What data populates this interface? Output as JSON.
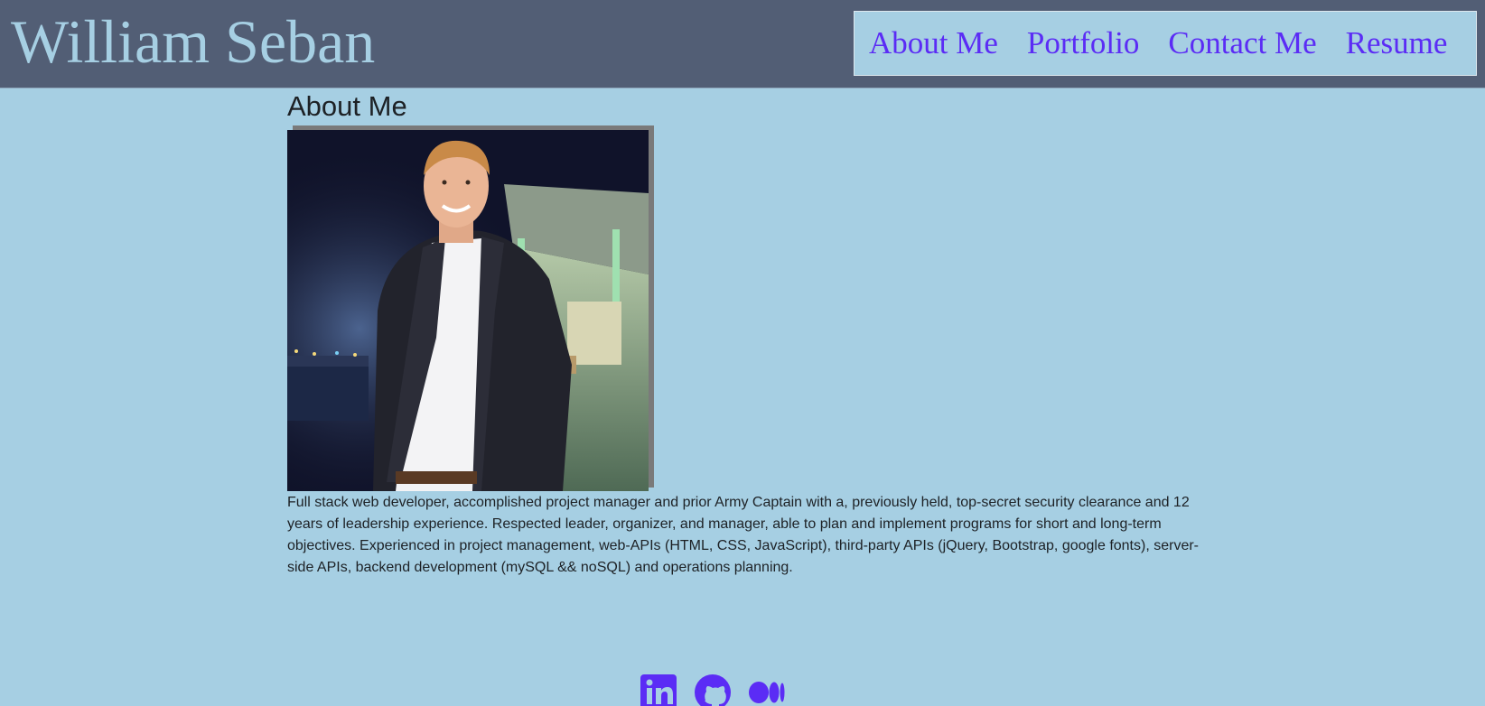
{
  "header": {
    "site_title": "William Seban",
    "nav": [
      {
        "label": "About Me"
      },
      {
        "label": "Portfolio"
      },
      {
        "label": "Contact Me"
      },
      {
        "label": "Resume"
      }
    ]
  },
  "main": {
    "section_title": "About Me",
    "bio": "Full stack web developer, accomplished project manager and prior Army Captain with a, previously held, top-secret security clearance and 12 years of leadership experience. Respected leader, organizer, and manager, able to plan and implement programs for short and long-term objectives. Experienced in project management, web-APIs (HTML, CSS, JavaScript), third-party APIs (jQuery, Bootstrap, google fonts), server-side APIs, backend development (mySQL && noSQL) and operations planning."
  },
  "footer": {
    "social_icons": [
      "linkedin-icon",
      "github-icon",
      "medium-icon"
    ]
  },
  "colors": {
    "background": "#a6cfe3",
    "header_bg": "#525e75",
    "link": "#5b2cf5",
    "text": "#1d2125"
  }
}
